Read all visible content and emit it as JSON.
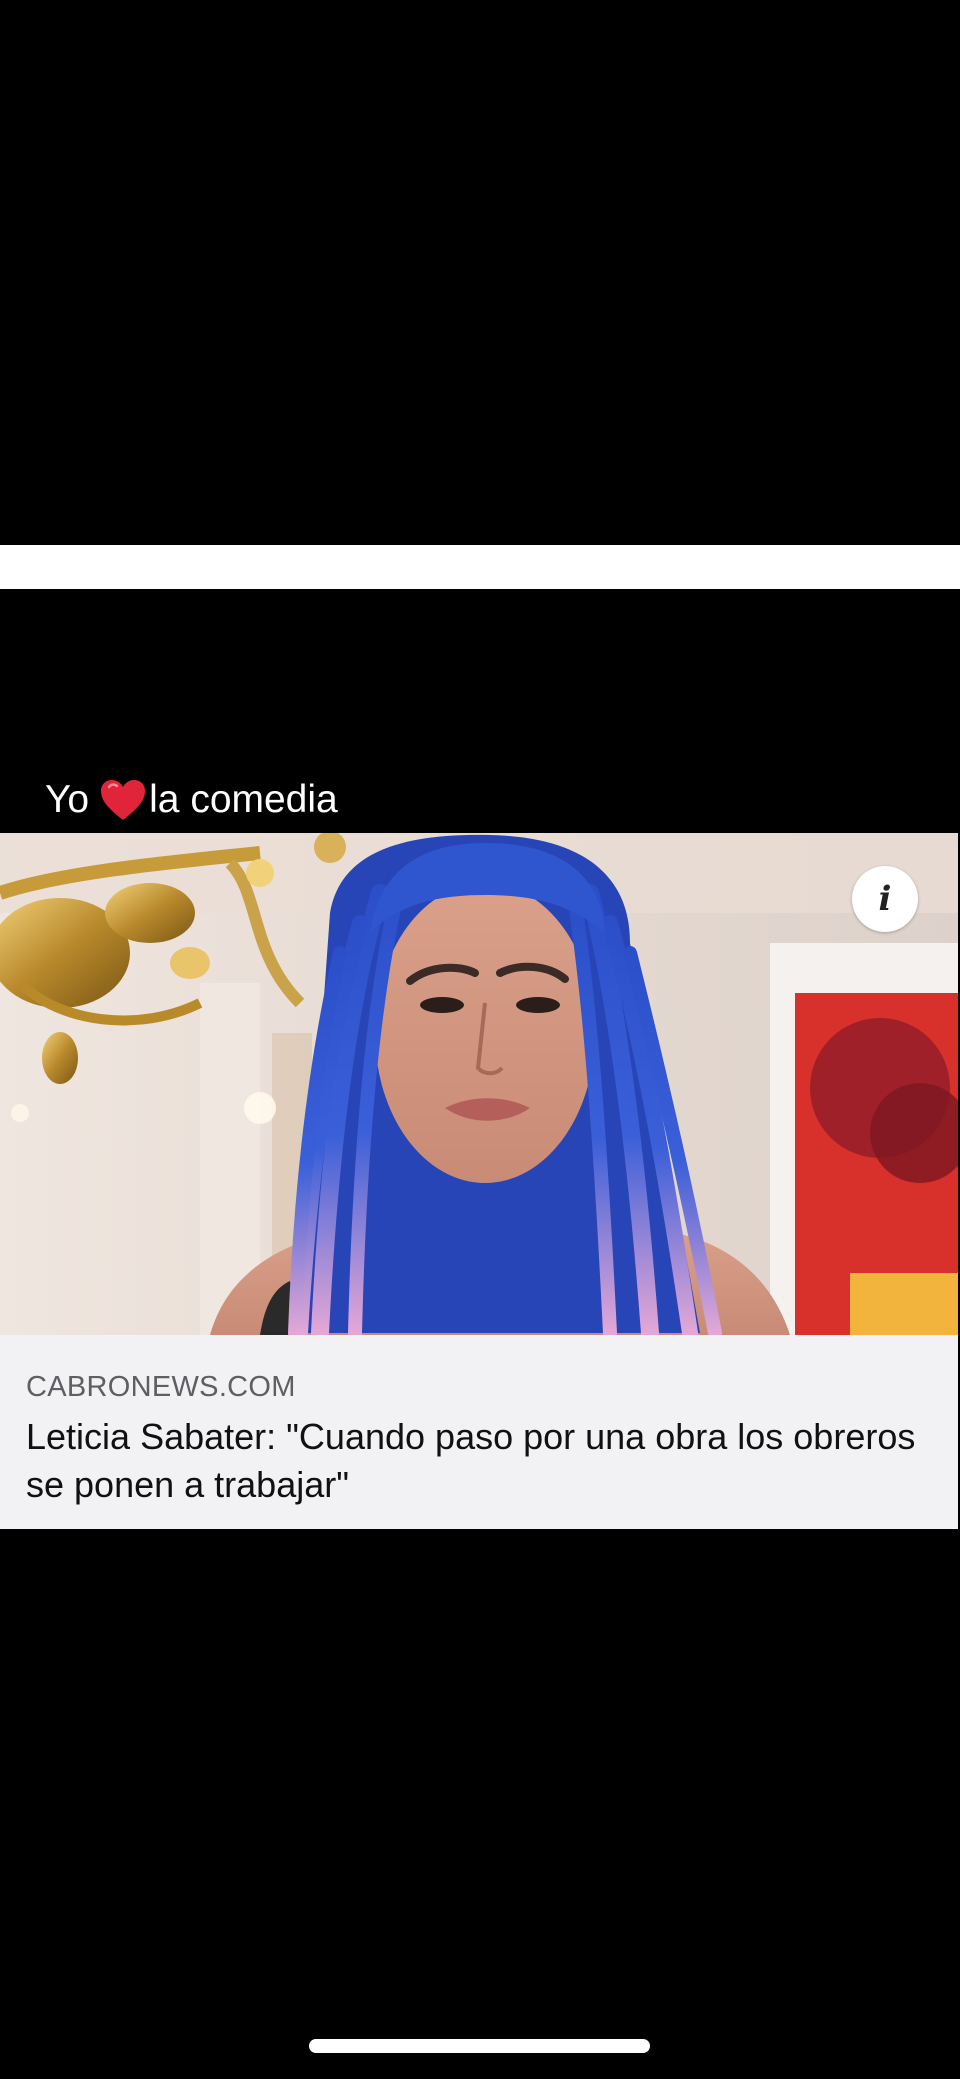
{
  "post": {
    "caption_before": "Yo",
    "caption_after": "la comedia",
    "caption_icon": "red-heart-emoji"
  },
  "link_card": {
    "source": "CABRONEWS.COM",
    "headline": "Leticia Sabater: \"Cuando paso por una obra los obreros se ponen a trabajar\"",
    "info_icon": "info-icon"
  },
  "colors": {
    "background": "#000000",
    "card_background": "#f2f2f4",
    "heart": "#e0243a",
    "hair_blue": "#2a4ec8",
    "hair_pink": "#e3a7d6"
  }
}
